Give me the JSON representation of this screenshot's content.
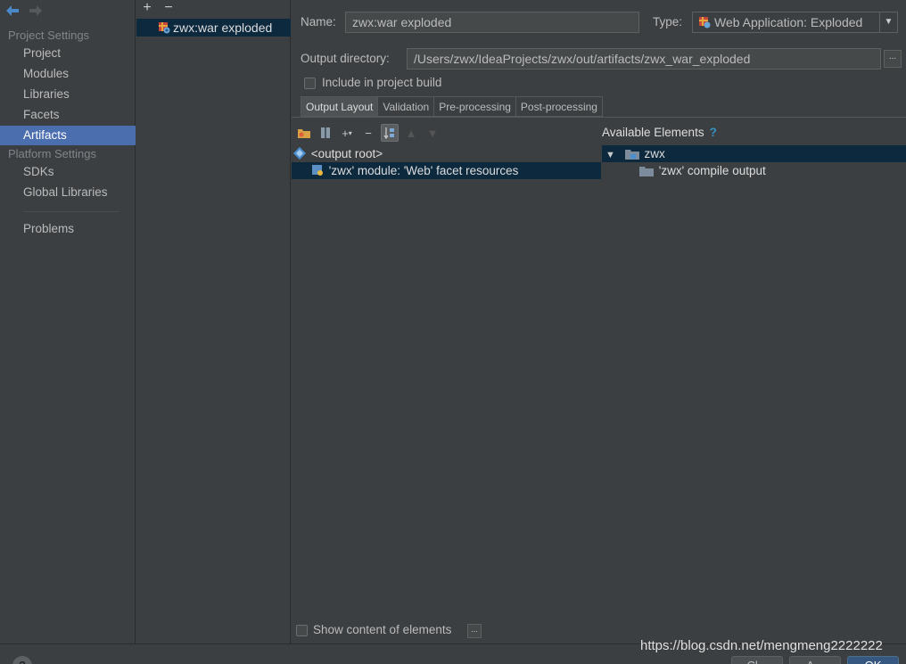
{
  "nav": {
    "project_settings_header": "Project Settings",
    "project_items": [
      "Project",
      "Modules",
      "Libraries",
      "Facets",
      "Artifacts"
    ],
    "selected_item": "Artifacts",
    "platform_settings_header": "Platform Settings",
    "platform_items": [
      "SDKs",
      "Global Libraries"
    ],
    "problems": "Problems"
  },
  "artifacts_panel": {
    "add_glyph": "+",
    "remove_glyph": "−",
    "selected_artifact": "zwx:war exploded"
  },
  "form": {
    "name_label": "Name:",
    "name_value": "zwx:war exploded",
    "type_label": "Type:",
    "type_value": "Web Application: Exploded",
    "output_dir_label": "Output directory:",
    "output_dir_value": "/Users/zwx/IdeaProjects/zwx/out/artifacts/zwx_war_exploded",
    "browse_glyph": "...",
    "include_build_label": "Include in project build",
    "include_build_checked": false
  },
  "tabs": [
    {
      "label": "Output Layout",
      "active": true
    },
    {
      "label": "Validation",
      "active": false
    },
    {
      "label": "Pre-processing",
      "active": false
    },
    {
      "label": "Post-processing",
      "active": false
    }
  ],
  "layout_tree": {
    "root_label": "<output root>",
    "child_label": "'zwx' module: 'Web' facet resources"
  },
  "available": {
    "header": "Available Elements",
    "help_glyph": "?",
    "module_label": "zwx",
    "compile_output_label": "'zwx' compile output"
  },
  "footer": {
    "show_content_label": "Show content of elements",
    "show_content_checked": false,
    "more_glyph": "...",
    "help_glyph": "?",
    "watermark": "https://blog.csdn.net/mengmeng2222222",
    "buttons": [
      "Cl...",
      "A...",
      "OK"
    ]
  },
  "colors": {
    "background": "#3c3f41",
    "selection": "#4b6eaf",
    "tree_selection": "#0d293e",
    "accent_help": "#3592c4"
  }
}
